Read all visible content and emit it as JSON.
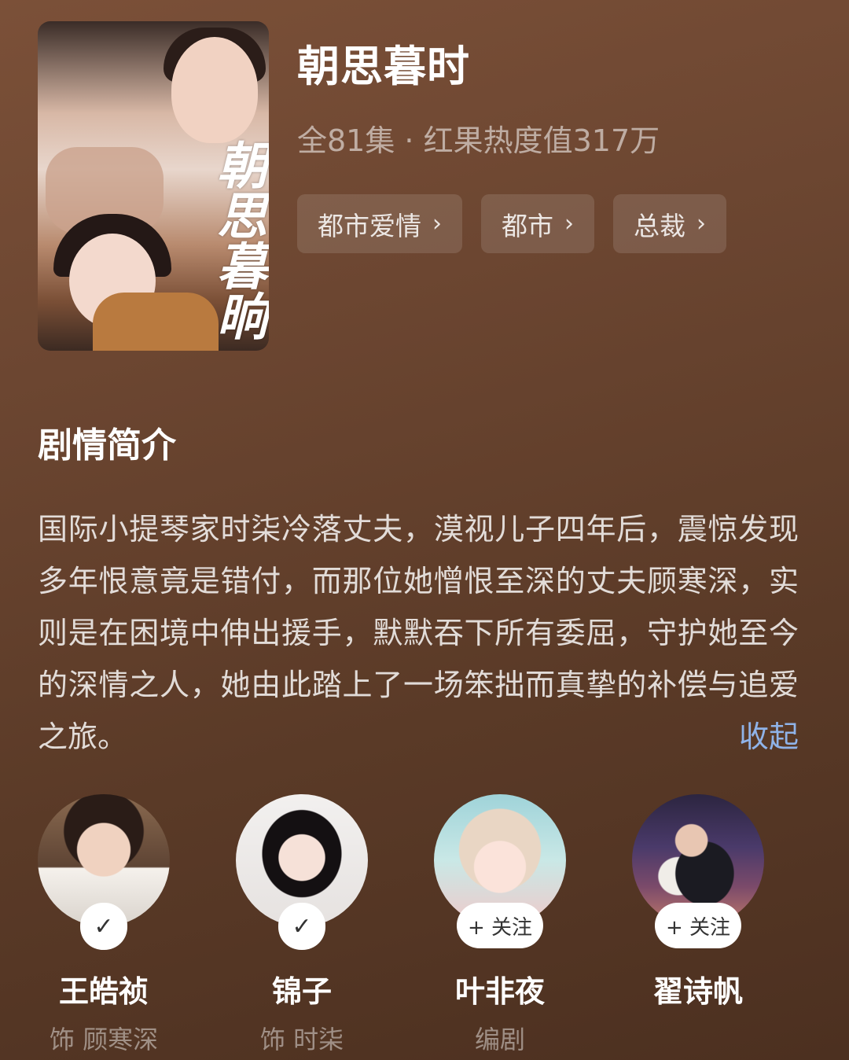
{
  "show": {
    "title": "朝思暮时",
    "meta": "全81集 · 红果热度值317万",
    "poster_calligraphy": "朝思暮晌",
    "tags": [
      {
        "label": "都市爱情"
      },
      {
        "label": "都市"
      },
      {
        "label": "总裁"
      }
    ]
  },
  "synopsis": {
    "heading": "剧情简介",
    "text": "国际小提琴家时柒冷落丈夫，漠视儿子四年后，震惊发现多年恨意竟是错付，而那位她憎恨至深的丈夫顾寒深，实则是在困境中伸出援手，默默吞下所有委屈，守护她至今的深情之人，她由此踏上了一场笨拙而真挚的补偿与追爱之旅。",
    "collapse_label": "收起"
  },
  "cast": [
    {
      "name": "王皓祯",
      "role": "饰 顾寒深",
      "followed": true,
      "badge": "✓"
    },
    {
      "name": "锦子",
      "role": "饰 时柒",
      "followed": true,
      "badge": "✓"
    },
    {
      "name": "叶非夜",
      "role": "编剧",
      "followed": false,
      "badge": "+ 关注"
    },
    {
      "name": "翟诗帆",
      "role": "",
      "followed": false,
      "badge": "+ 关注"
    }
  ],
  "icons": {
    "chevron": "chevron-right-icon",
    "check": "check-icon",
    "plus": "plus-icon"
  },
  "colors": {
    "background": "#6c4631",
    "link": "#8fb3e8"
  }
}
